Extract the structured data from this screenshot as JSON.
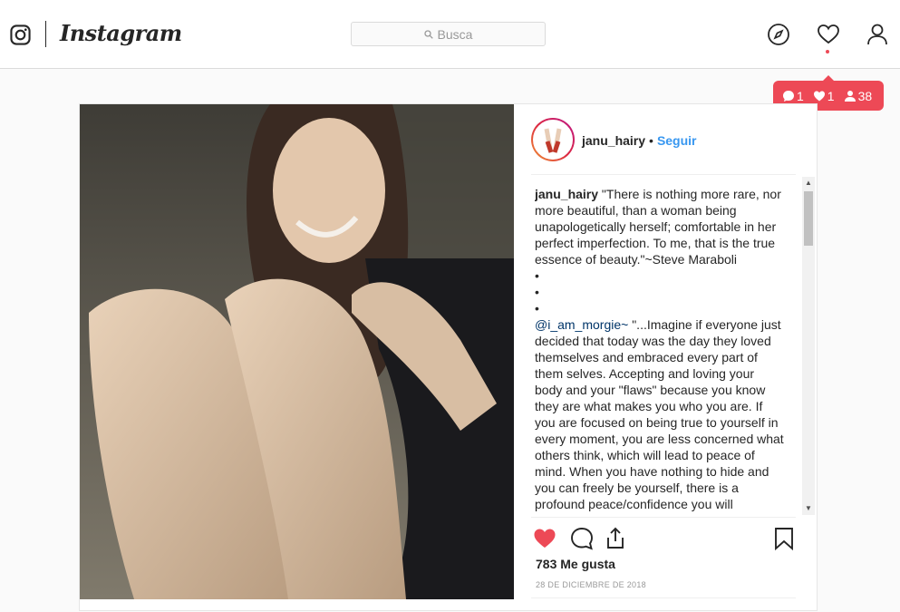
{
  "topbar": {
    "brand": "Instagram",
    "search_placeholder": "Busca",
    "icons": [
      "instagram-camera-icon",
      "compass-icon",
      "heart-icon",
      "profile-icon"
    ]
  },
  "notifications": {
    "comments": "1",
    "likes": "1",
    "follows": "38"
  },
  "post": {
    "username": "janu_hairy",
    "separator": "•",
    "follow_label": "Seguir",
    "caption_author": "janu_hairy",
    "caption_text": "\"There is nothing more rare, nor more beautiful, than a woman being unapologetically herself; comfortable in her perfect imperfection. To me, that is the true essence of beauty.\"~Steve Maraboli",
    "bullets": [
      "•",
      "•",
      "•"
    ],
    "mention": "@i_am_morgie~",
    "quote": "\"...Imagine if everyone just decided that today was the day they loved themselves and embraced every part of them selves. Accepting and loving your body and your \"flaws\" because you know they are what makes you who you are. If you are focused on being true to yourself in every moment, you are less concerned what others think, which will lead to peace of mind. When you have nothing to hide and you can freely be yourself, there is a profound peace/confidence you will",
    "likes_text": "783 Me gusta",
    "date": "28 DE DICIEMBRE DE 2018"
  },
  "colors": {
    "accent_blue": "#3897f0",
    "like_red": "#ed4956",
    "border": "#dbdbdb"
  }
}
